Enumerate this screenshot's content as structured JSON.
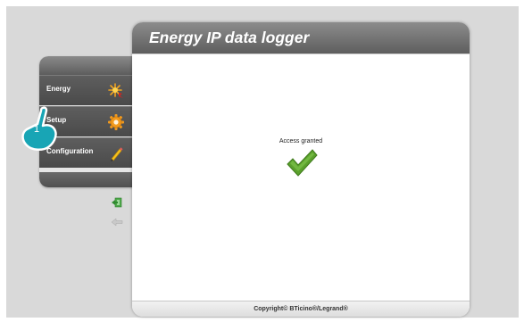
{
  "main": {
    "title": "Energy IP data logger",
    "status_text": "Access granted",
    "footer_text": "Copyright© BTicino®/Legrand®"
  },
  "sidebar": {
    "items": [
      {
        "label": "Energy",
        "icon": "energy-icon"
      },
      {
        "label": "Setup",
        "icon": "gear-icon"
      },
      {
        "label": "Configuration",
        "icon": "pencil-icon"
      }
    ]
  },
  "side_icons": [
    "logout-icon",
    "back-arrow-icon"
  ],
  "callout": {
    "number": "1"
  },
  "colors": {
    "header": "#6e6e6e",
    "sidebar_item": "#555555",
    "accent_green": "#5aa02c",
    "gear": "#f29a1d"
  }
}
